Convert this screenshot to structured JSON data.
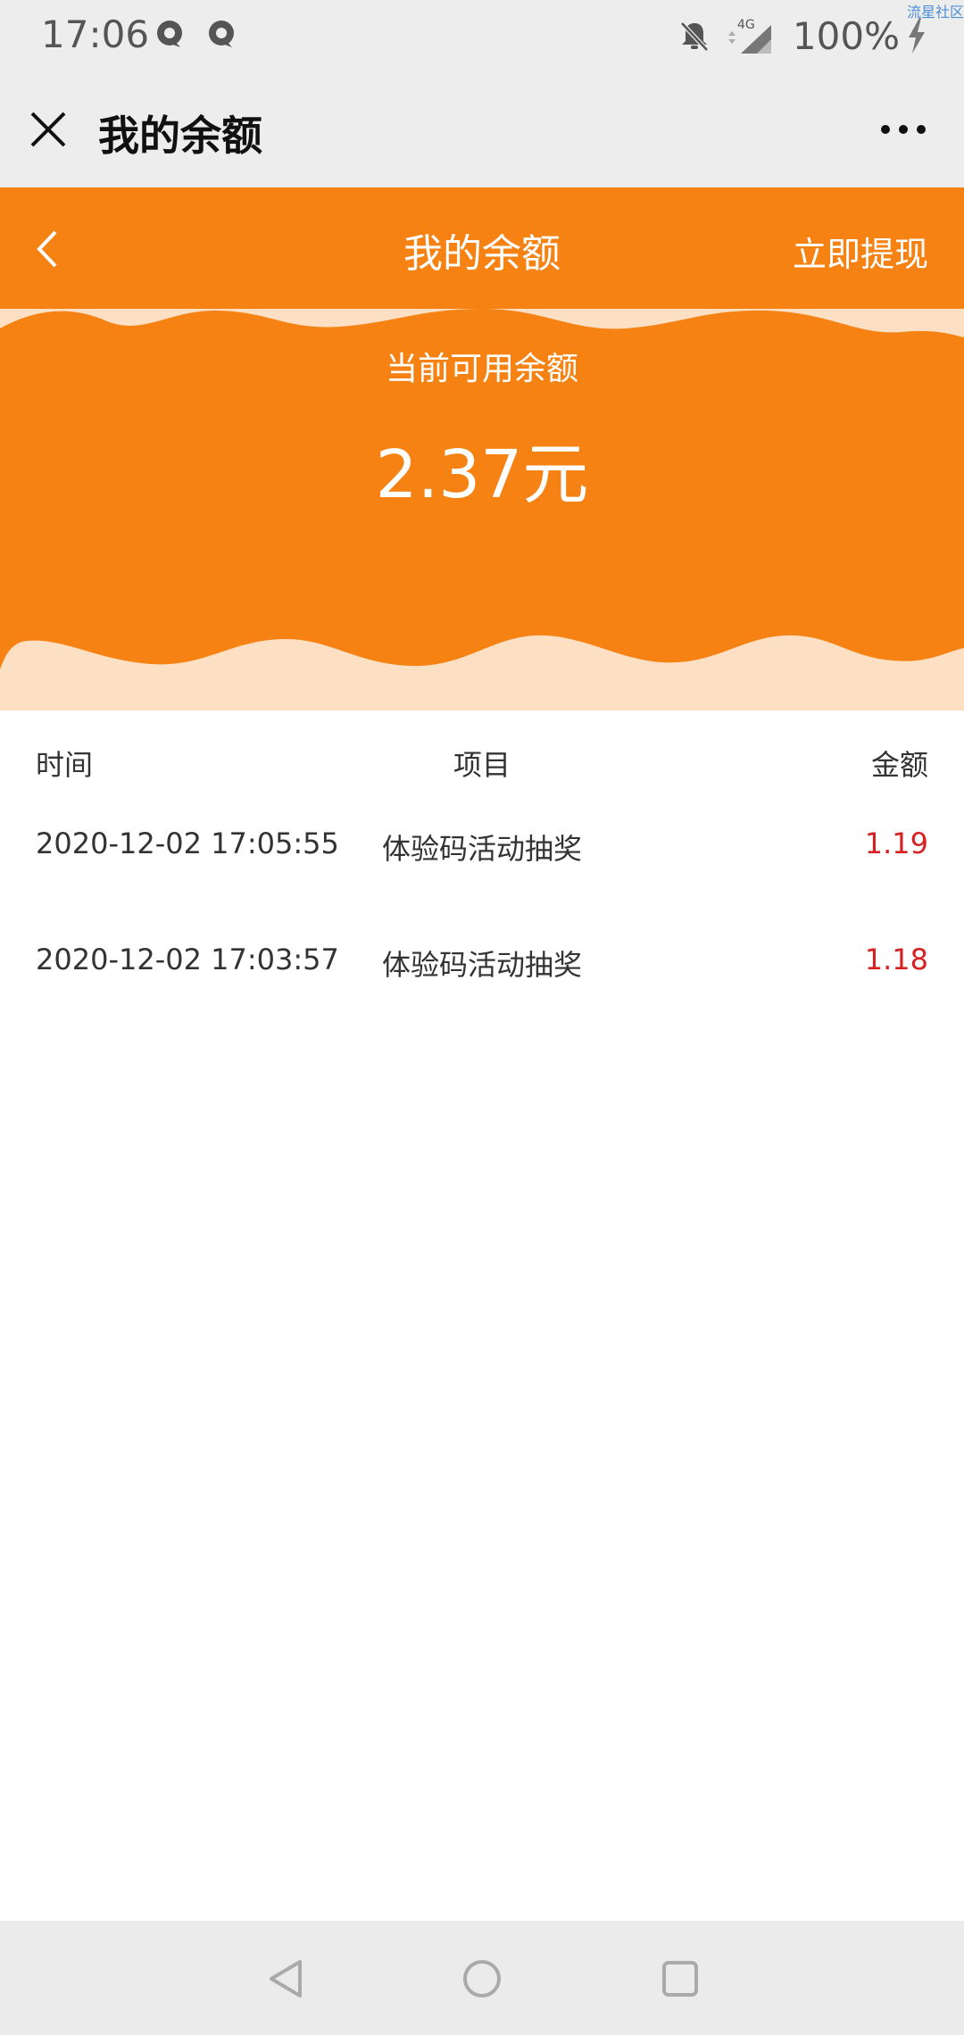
{
  "status_bar": {
    "time": "17:06",
    "network": "4G",
    "battery": "100%",
    "watermark": "流星社区"
  },
  "wx_bar": {
    "title": "我的余额"
  },
  "page_header": {
    "title": "我的余额",
    "withdraw_label": "立即提现"
  },
  "balance": {
    "label": "当前可用余额",
    "amount": "2.37元"
  },
  "transactions": {
    "columns": [
      "时间",
      "项目",
      "金额"
    ],
    "rows": [
      {
        "time": "2020-12-02 17:05:55",
        "item": "体验码活动抽奖",
        "amount": "1.19"
      },
      {
        "time": "2020-12-02 17:03:57",
        "item": "体验码活动抽奖",
        "amount": "1.18"
      }
    ]
  },
  "colors": {
    "accent": "#f58212",
    "banner_light": "#fde0c4",
    "amount": "#d62222",
    "system_bar": "#ededed"
  }
}
